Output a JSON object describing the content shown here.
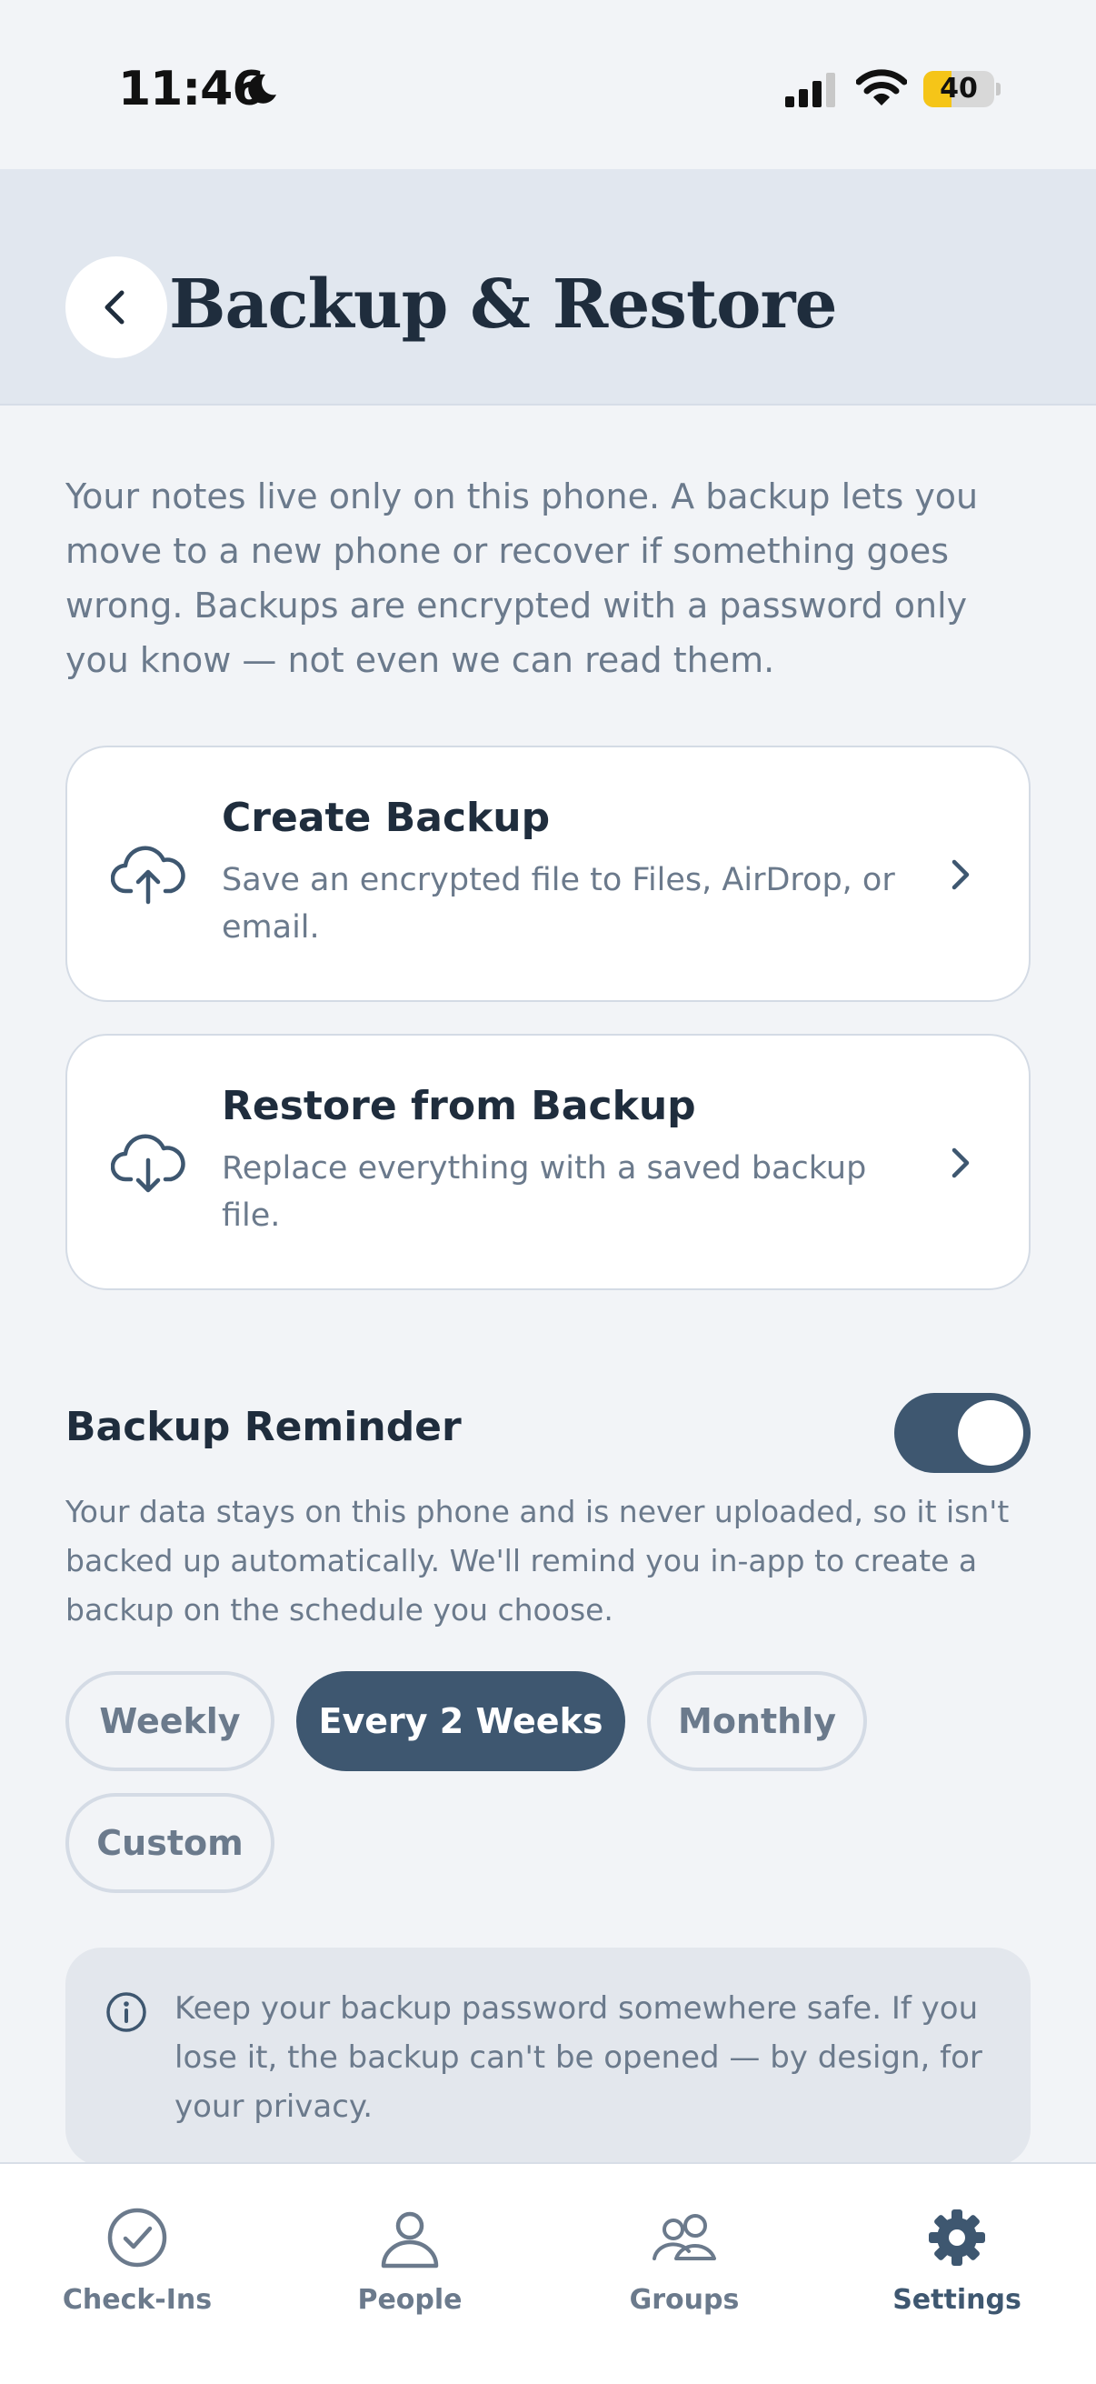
{
  "status_bar": {
    "time": "11:46",
    "battery_level": 40,
    "battery_label": "40",
    "battery_color": "#f5c518"
  },
  "header": {
    "title": "Backup & Restore",
    "back_icon": "chevron-left-icon",
    "background": "#e1e7ef"
  },
  "intro": "Your notes live only on this phone. A backup lets you move to a new phone or recover if something goes wrong. Backups are encrypted with a password only you know — not even we can read them.",
  "actions": [
    {
      "title": "Create Backup",
      "subtitle": "Save an encrypted file to Files, AirDrop, or email.",
      "icon": "cloud-upload-icon"
    },
    {
      "title": "Restore from Backup",
      "subtitle": "Replace everything with a saved backup file.",
      "icon": "cloud-download-icon"
    }
  ],
  "reminder": {
    "title": "Backup Reminder",
    "enabled": true,
    "description": "Your data stays on this phone and is never uploaded, so it isn't backed up automatically. We'll remind you in-app to create a backup on the schedule you choose.",
    "options": [
      "Weekly",
      "Every 2 Weeks",
      "Monthly",
      "Custom"
    ],
    "selected": "Every 2 Weeks"
  },
  "info": {
    "icon": "info-icon",
    "text": "Keep your backup password somewhere safe. If you lose it, the backup can't be opened — by design, for your privacy."
  },
  "tabs": [
    {
      "label": "Check-Ins",
      "icon": "check-circle-icon",
      "active": false
    },
    {
      "label": "People",
      "icon": "person-icon",
      "active": false
    },
    {
      "label": "Groups",
      "icon": "group-icon",
      "active": false
    },
    {
      "label": "Settings",
      "icon": "gear-icon",
      "active": true
    }
  ],
  "colors": {
    "accent": "#3e5770",
    "background": "#f2f4f7",
    "muted_text": "#6b7a8c",
    "title_text": "#1f2d3d"
  }
}
